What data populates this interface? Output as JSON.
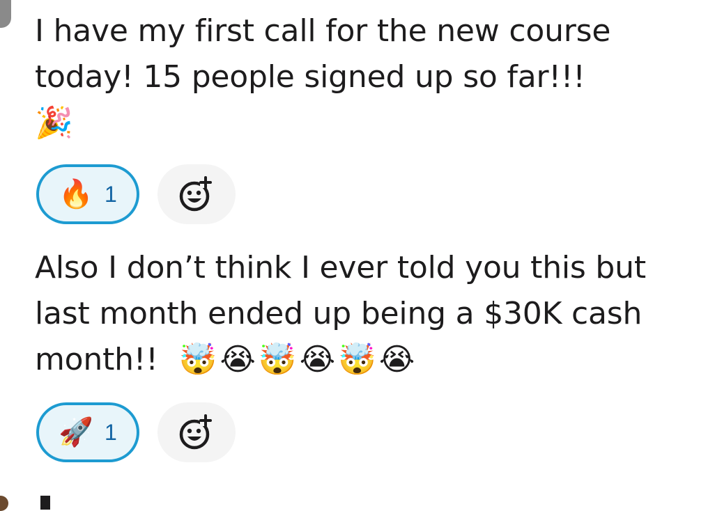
{
  "messages": [
    {
      "text": "I have my first call for the new course today! 15 people signed up so far!!!",
      "emoji": "🎉",
      "reaction": {
        "emoji": "🔥",
        "count": "1",
        "icon": "fire-icon"
      }
    },
    {
      "text": "Also I don’t think I ever told you this but last month ended up being a $30K cash month!!",
      "emojis": [
        "🤯",
        "😭",
        "🤯",
        "😭",
        "🤯",
        "😭"
      ],
      "reaction": {
        "emoji": "🚀",
        "count": "1",
        "icon": "rocket-icon"
      }
    }
  ],
  "add_reaction_icon": "add-reaction-icon",
  "colors": {
    "reaction_border": "#1d9bd1",
    "reaction_bg": "#e8f5fa",
    "reaction_count": "#1264a3",
    "add_reaction_bg": "#f4f4f4",
    "text": "#1d1c1d"
  }
}
